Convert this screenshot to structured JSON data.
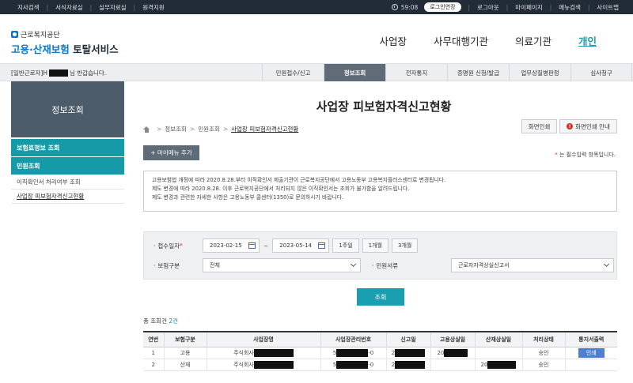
{
  "topbar": {
    "links": [
      "지사검색",
      "서식자료실",
      "실무자료실",
      "원격지원"
    ],
    "timer": "59:08",
    "extend_label": "로그인연장",
    "right_links": [
      "로그아웃",
      "마이페이지",
      "메뉴검색",
      "사이트맵"
    ]
  },
  "header": {
    "org_name": "근로복지공단",
    "service_blue": "고용·산재보험",
    "service_dark": "토탈서비스",
    "nav": [
      "사업장",
      "사무대행기관",
      "의료기관",
      "개인"
    ]
  },
  "subnav": {
    "user_prefix": "[일반근로자] ",
    "user_first": "H",
    "user_suffix": "님 반갑습니다.",
    "tabs": [
      "민원접수/신고",
      "정보조회",
      "전자통지",
      "증명원 신청/발급",
      "업무상질병판정",
      "심사청구"
    ]
  },
  "sidebar": {
    "title": "정보조회",
    "items": [
      "보험료정보 조회",
      "민원조회"
    ],
    "subs": [
      "이직확인서 처리여부 조회",
      "사업장 피보험자격신고현황"
    ]
  },
  "page": {
    "title": "사업장 피보험자격신고현황",
    "breadcrumb": [
      "정보조회",
      "민원조회",
      "사업장 피보험자격신고현황"
    ],
    "print_label": "화면인쇄",
    "print_guide_label": "화면인쇄 안내",
    "mymenu_label": "+ 마이메뉴 추가",
    "required_star": "*",
    "required_note": "는 필수입력 항목입니다.",
    "notice": [
      "고용보험법 개정에 따라 2020.8.28.부터 이직확인서 제출기관이 근로복지공단에서 고용노동부 고용복지플러스센터로 변경됩니다.",
      "제도 변경에 따라 2020.8.28. 이후 근로복지공단에서 처리되지 않은 이직확인서는 조회가 불가함을 알려드립니다.",
      "제도 변경과 관련한 자세한 사항은 고용노동부 콜센터(1350)로 문의하시기 바랍니다."
    ]
  },
  "search": {
    "date_label": "접수일자",
    "date_from": "2023-02-15",
    "date_to": "2023-05-14",
    "periods": [
      "1주일",
      "1개월",
      "3개월"
    ],
    "insurance_label": "보험구분",
    "insurance_value": "전체",
    "doc_label": "민원서류",
    "doc_value": "근로자자격상실신고서",
    "submit_label": "조회"
  },
  "results": {
    "count_prefix": "총 조회건 ",
    "count_value": "2건",
    "headers": [
      "연번",
      "보험구분",
      "사업장명",
      "사업장관리번호",
      "신고일",
      "고용상실일",
      "산재상실일",
      "처리상태",
      "통지서출력"
    ],
    "rows": [
      {
        "no": "1",
        "type": "고용",
        "name": "주식회사",
        "mgmt_a": "5",
        "mgmt_b": "-0",
        "report": "2",
        "emp_loss": "20",
        "ind_loss": "",
        "status": "승인",
        "print": "인쇄"
      },
      {
        "no": "2",
        "type": "산재",
        "name": "주식회사",
        "mgmt_a": "5",
        "mgmt_b": "-0",
        "report": "2",
        "emp_loss": "",
        "ind_loss": "20",
        "status": "승인",
        "print": ""
      }
    ]
  }
}
